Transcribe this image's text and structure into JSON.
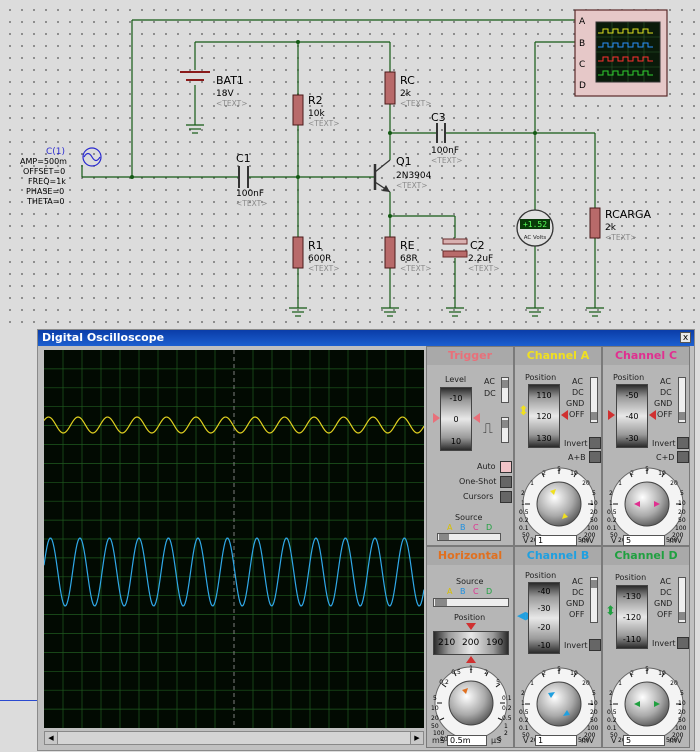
{
  "schematic": {
    "bat1": {
      "name": "BAT1",
      "value": "18V",
      "text": "<TEXT>"
    },
    "r2": {
      "name": "R2",
      "value": "10k",
      "text": "<TEXT>"
    },
    "rc": {
      "name": "RC",
      "value": "2k",
      "text": "<TEXT>"
    },
    "c1": {
      "name": "C1",
      "value": "100nF",
      "text": "<TEXT>"
    },
    "c3": {
      "name": "C3",
      "value": "100nF",
      "text": "<TEXT>"
    },
    "q1": {
      "name": "Q1",
      "value": "2N3904",
      "text": "<TEXT>"
    },
    "r1": {
      "name": "R1",
      "value": "600R",
      "text": "<TEXT>"
    },
    "re": {
      "name": "RE",
      "value": "68R",
      "text": "<TEXT>"
    },
    "c2": {
      "name": "C2",
      "value": "2.2uF",
      "text": "<TEXT>"
    },
    "rcarga": {
      "name": "RCARGA",
      "value": "2k",
      "text": "<TEXT>"
    },
    "source": {
      "name": "C(1)",
      "lines": [
        "AMP=500m",
        "OFFSET=0",
        "FREQ=1k",
        "PHASE=0",
        "THETA=0"
      ]
    },
    "voltmeter": {
      "reading": "+1.52",
      "unit": "AC Volts"
    },
    "scope_pins": [
      "A",
      "B",
      "C",
      "D"
    ]
  },
  "oscilloscope": {
    "title": "Digital Oscilloscope",
    "close": "x",
    "trigger": {
      "title": "Trigger",
      "level": "Level",
      "drum": [
        "-10",
        "0",
        "10"
      ],
      "ac": "AC",
      "dc": "DC",
      "auto": "Auto",
      "oneshot": "One-Shot",
      "cursors": "Cursors",
      "source": "Source",
      "source_letters": [
        "A",
        "B",
        "C",
        "D"
      ]
    },
    "channel_a": {
      "title": "Channel A",
      "position": "Position",
      "drum": [
        "110",
        "120",
        "130"
      ],
      "modes": [
        "AC",
        "DC",
        "GND",
        "OFF"
      ],
      "invert": "Invert",
      "sum": "A+B",
      "unit_left": "V",
      "value": "1",
      "unit_right": "mV"
    },
    "channel_c": {
      "title": "Channel C",
      "position": "Position",
      "drum": [
        "-50",
        "-40",
        "-30"
      ],
      "modes": [
        "AC",
        "DC",
        "GND",
        "OFF"
      ],
      "invert": "Invert",
      "sum": "C+D",
      "unit_left": "V",
      "value": "5",
      "unit_right": "mV"
    },
    "channel_b": {
      "title": "Channel B",
      "position": "Position",
      "drum": [
        "-40",
        "-30",
        "-20",
        "-10"
      ],
      "modes": [
        "AC",
        "DC",
        "GND",
        "OFF"
      ],
      "invert": "Invert",
      "unit_left": "V",
      "value": "1",
      "unit_right": "mV"
    },
    "channel_d": {
      "title": "Channel D",
      "position": "Position",
      "drum": [
        "-130",
        "-120",
        "-110"
      ],
      "modes": [
        "AC",
        "DC",
        "GND",
        "OFF"
      ],
      "invert": "Invert",
      "unit_left": "V",
      "value": "5",
      "unit_right": "mV"
    },
    "horizontal": {
      "title": "Horizontal",
      "source": "Source",
      "source_letters": [
        "A",
        "B",
        "C",
        "D"
      ],
      "position": "Position",
      "drum": [
        "210",
        "200",
        "190"
      ],
      "unit_left": "mS",
      "value": "0.5m",
      "unit_right": "µS"
    },
    "volt_dial": {
      "left": [
        "2",
        "1",
        "0.5",
        "0.2",
        "0.1",
        "50",
        "20"
      ],
      "right": [
        "5",
        "10",
        "20",
        "50",
        "100",
        "200",
        "500"
      ],
      "top": [
        "1",
        "2",
        "5",
        "10",
        "20"
      ]
    },
    "time_dial": {
      "left": [
        "5",
        "10",
        "20",
        "50",
        "100",
        "200"
      ],
      "right": [
        "0.1",
        "0.2",
        "0.5",
        "1",
        "2",
        "5"
      ],
      "top": [
        "0.2",
        "0.5",
        "1",
        "2",
        "5"
      ]
    },
    "colors": {
      "trigger": "#e8707a",
      "channel_a": "#f0e020",
      "channel_b": "#20a0e0",
      "channel_c": "#e03090",
      "channel_d": "#20a040",
      "horizontal": "#e07020"
    }
  }
}
